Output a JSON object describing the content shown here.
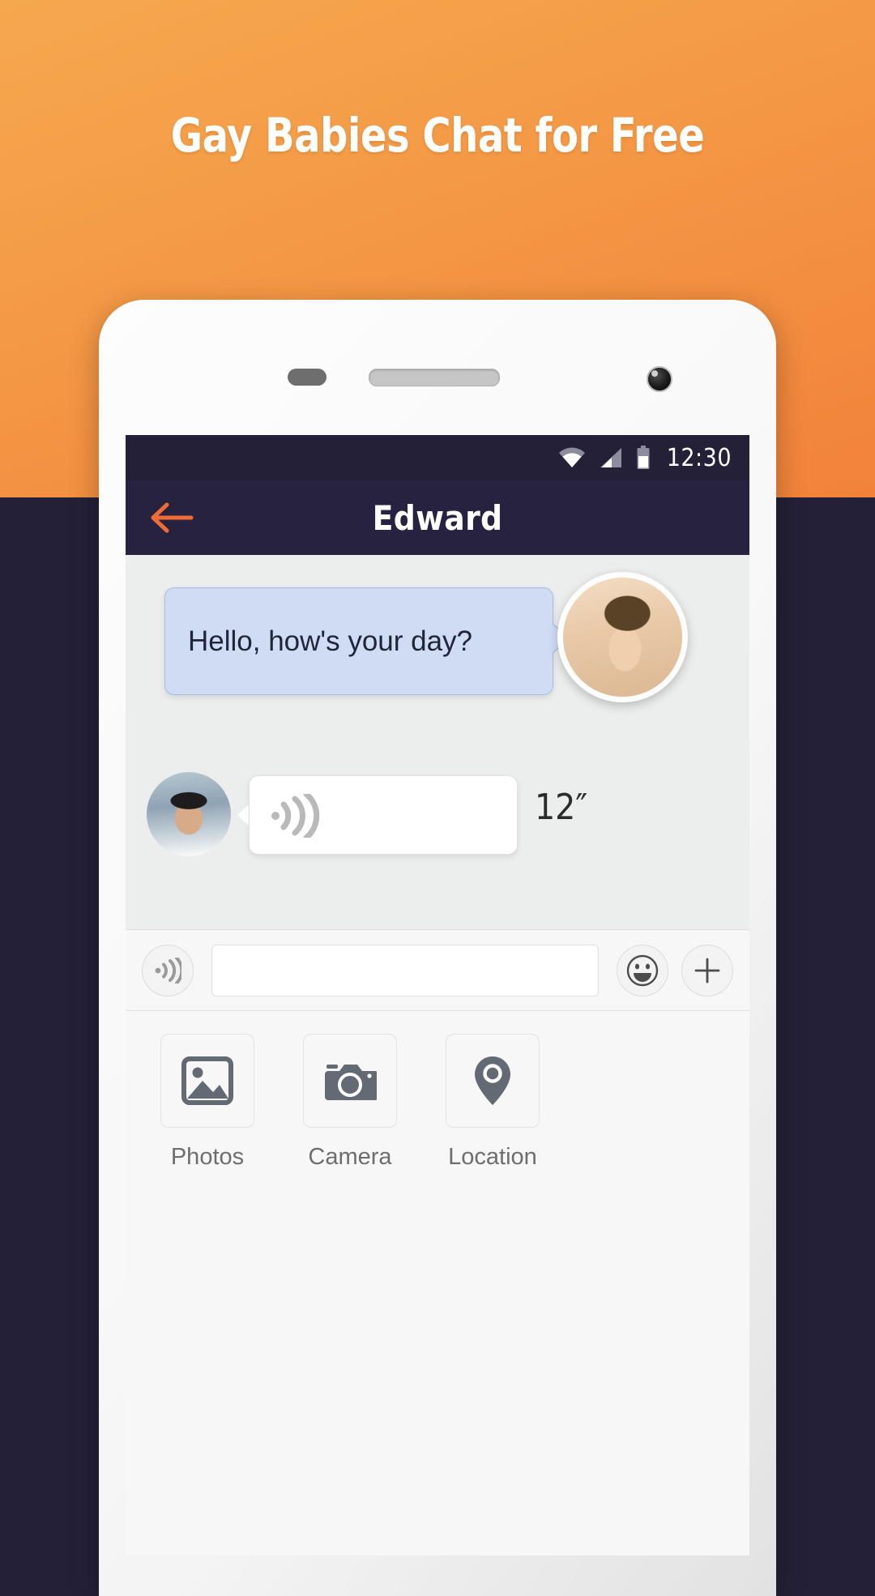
{
  "promo": {
    "headline": "Gay Babies Chat for Free",
    "background_top_color": "#f6a84f",
    "background_bottom_color": "#f2823a",
    "background_dark_color": "#242038"
  },
  "statusbar": {
    "time": "12:30",
    "icons": [
      "wifi-icon",
      "cellular-signal-icon",
      "battery-icon"
    ],
    "background_color": "#242038"
  },
  "appbar": {
    "title": "Edward",
    "back_icon": "back-arrow-icon",
    "accent_color": "#f26b36",
    "background_color": "#262240"
  },
  "conversation": {
    "messages": [
      {
        "direction": "incoming",
        "type": "text",
        "text": "Hello, how's your day?",
        "bubble_color": "#cfdcf4",
        "avatar": "peer-avatar"
      },
      {
        "direction": "outgoing",
        "type": "voice",
        "icon": "sound-wave-icon",
        "duration": "12″",
        "bubble_color": "#ffffff",
        "avatar": "self-avatar"
      }
    ]
  },
  "inputbar": {
    "voice_icon": "voice-record-icon",
    "input_value": "",
    "input_placeholder": "",
    "emoji_icon": "emoji-smiley-icon",
    "add_icon": "plus-icon"
  },
  "attachments": {
    "items": [
      {
        "label": "Photos",
        "icon": "photo-icon"
      },
      {
        "label": "Camera",
        "icon": "camera-icon"
      },
      {
        "label": "Location",
        "icon": "location-pin-icon"
      }
    ]
  }
}
